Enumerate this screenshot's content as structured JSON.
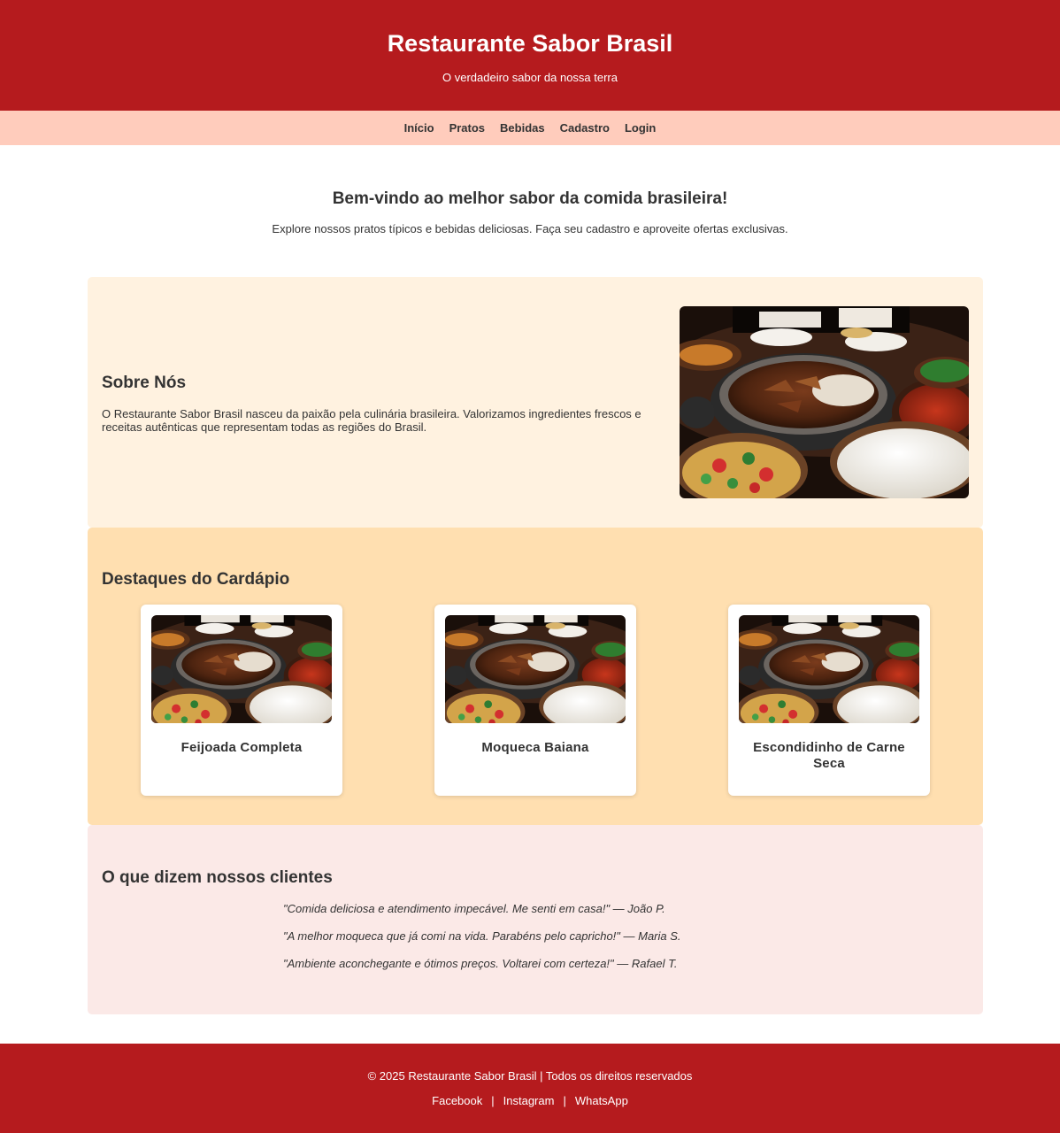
{
  "header": {
    "title": "Restaurante Sabor Brasil",
    "tagline": "O verdadeiro sabor da nossa terra"
  },
  "nav": {
    "items": [
      "Início",
      "Pratos",
      "Bebidas",
      "Cadastro",
      "Login"
    ]
  },
  "welcome": {
    "heading": "Bem-vindo ao melhor sabor da comida brasileira!",
    "text": "Explore nossos pratos típicos e bebidas deliciosas. Faça seu cadastro e aproveite ofertas exclusivas."
  },
  "about": {
    "heading": "Sobre Nós",
    "text": "O Restaurante Sabor Brasil nasceu da paixão pela culinária brasileira. Valorizamos ingredientes frescos e receitas autênticas que representam todas as regiões do Brasil."
  },
  "menu": {
    "heading": "Destaques do Cardápio",
    "dishes": [
      {
        "name": "Feijoada Completa"
      },
      {
        "name": "Moqueca Baiana"
      },
      {
        "name": "Escondidinho de Carne Seca"
      }
    ]
  },
  "testimonials": {
    "heading": "O que dizem nossos clientes",
    "items": [
      "\"Comida deliciosa e atendimento impecável. Me senti em casa!\" — João P.",
      "\"A melhor moqueca que já comi na vida. Parabéns pelo capricho!\" — Maria S.",
      "\"Ambiente aconchegante e ótimos preços. Voltarei com certeza!\" — Rafael T."
    ]
  },
  "footer": {
    "copyright": "© 2025 Restaurante Sabor Brasil | Todos os direitos reservados",
    "links": [
      "Facebook",
      "Instagram",
      "WhatsApp"
    ],
    "separator": "|"
  },
  "colors": {
    "header_bg": "#b51b1e",
    "nav_bg": "#ffccbc",
    "about_bg": "#fff2e0",
    "menu_bg": "#ffdfb0",
    "testimonials_bg": "#fbe9e7"
  }
}
